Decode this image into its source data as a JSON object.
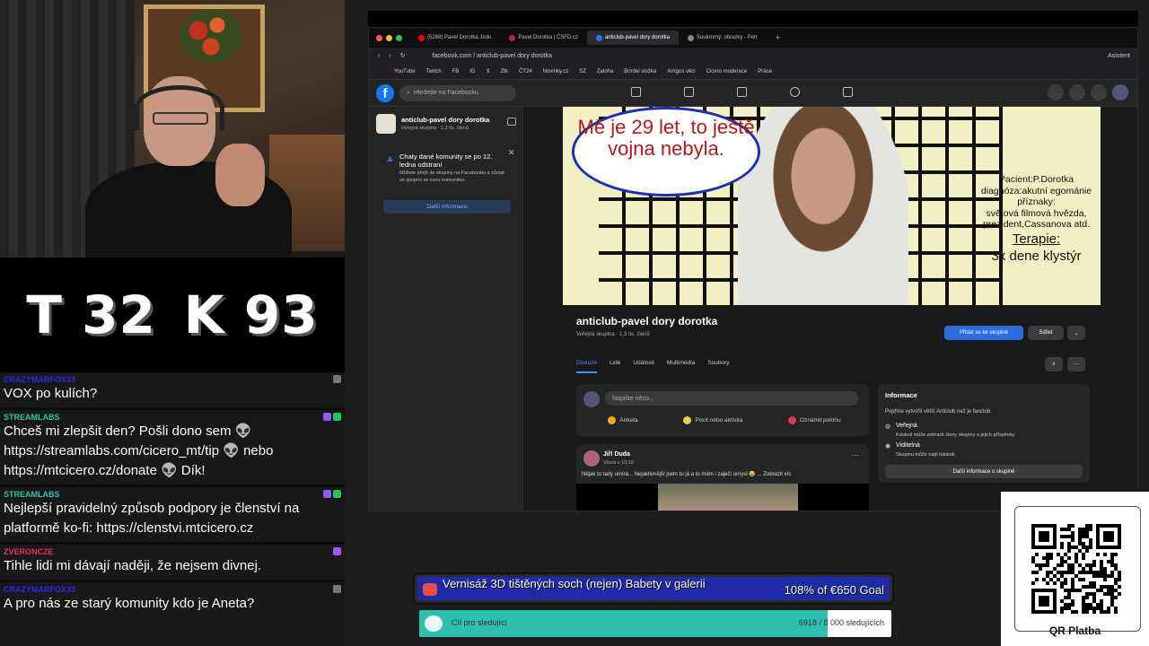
{
  "scoreboard": {
    "left": "T 32",
    "right": "K 93"
  },
  "chat": [
    {
      "user": "CRAZYMARFOX33",
      "user_color": "#2a2ae8",
      "text": "VOX po kulích?"
    },
    {
      "user": "STREAMLABS",
      "user_color": "#31c3a2",
      "text": "Chceš mi zlepšit den? Pošli dono sem 👽 https://streamlabs.com/cicero_mt/tip 👽 nebo https://mtcicero.cz/donate 👽 Dík!"
    },
    {
      "user": "STREAMLABS",
      "user_color": "#31c3a2",
      "text": "Nejlepší pravidelný způsob podpory je členství na platformě ko-fi: https://clenstvi.mtcicero.cz"
    },
    {
      "user": "ZVERONCZE",
      "user_color": "#e0305a",
      "text": "Tihle lidi mi dávají naději, že nejsem divnej."
    },
    {
      "user": "CRAZYMARFOX33",
      "user_color": "#2a2ae8",
      "text": "A pro nás ze starý komunity kdo je Aneta?"
    }
  ],
  "browser": {
    "tabs": [
      "(5268) Pavel Dorotka Jedu",
      "Pavel Dorotka | ČSFD.cz",
      "anticlub-pavel dory dorotka",
      "Soukromý: obrazky - Petr",
      "+"
    ],
    "url": "facebook.com / anticlub-pavel dory dorotka",
    "assistant": "Asistent",
    "bookmarks": [
      "YouTube",
      "Twitch",
      "FB",
      "IG",
      "X",
      "Ztk",
      "ČT24",
      "Novinky.cz",
      "SZ",
      "Zaloha",
      "Bordel složka",
      "Arrigos věci",
      "Cicero moderace",
      "Práce"
    ]
  },
  "facebook": {
    "search_placeholder": "Hledejte na Facebooku",
    "group_name": "anticlub-pavel dory dorotka",
    "group_sub": "Veřejná skupina · 1,3 tis. členů",
    "notice_title": "Chaty dané komunity se po 12. ledna odstraní",
    "notice_text": "Můžete přejít do skupiny na Facebooku a zůstat ve spojení se svou komunitou.",
    "notice_button": "Další informace",
    "cover_bubble": "Mě je 29 let, to ještě vojna nebyla.",
    "cover_patient": [
      "Pacient:P.Dorotka",
      "diagnóza:akutní egománie",
      "příznaky:",
      "světová filmová hvězda,",
      "prezident,Cassanova atd."
    ],
    "cover_therapy": "Terapie:",
    "cover_dose": "3x dene klystýr",
    "join_button": "Přidat se ke skupině",
    "share_button": "Sdílet",
    "tabs": [
      "Diskuze",
      "Lidé",
      "Události",
      "Multimédia",
      "Soubory"
    ],
    "compose_placeholder": "Napište něco...",
    "compose_actions": [
      "Anketa",
      "Pocit nebo aktivita",
      "Oznámit polohu"
    ],
    "post_author": "Jiří Duda",
    "post_time": "Včera v 10:10",
    "post_text": "Nějak to tady umírá... Nejaktivnější jsem tu já a to mám i zaječí urnysl 😂 ... Zobrazit víc",
    "info_title": "Informace",
    "info_desc": "Pojďme vytvořit větší Anticlub než je fanclub.",
    "info_public": "Veřejná",
    "info_public_desc": "Kdokoli může zobrazit členy skupiny a jejich příspěvky.",
    "info_visible": "Viditelná",
    "info_visible_desc": "Skupinu může najít kdokoli.",
    "info_more": "Další informace o skupině"
  },
  "goal": {
    "title": "Vernisáž 3D tištěných soch (nejen) Babety v galerii",
    "value": "108% of €650 Goal"
  },
  "follow": {
    "label": "Cíl pro sledující",
    "value": "6918 / 8 000 sledujících",
    "fraction": 0.865
  },
  "qr": {
    "label": "QR Platba"
  },
  "colors": {
    "fb_blue": "#1877f2",
    "goal_bg": "#1e2aa8",
    "follow_fill": "#2ebfae"
  }
}
